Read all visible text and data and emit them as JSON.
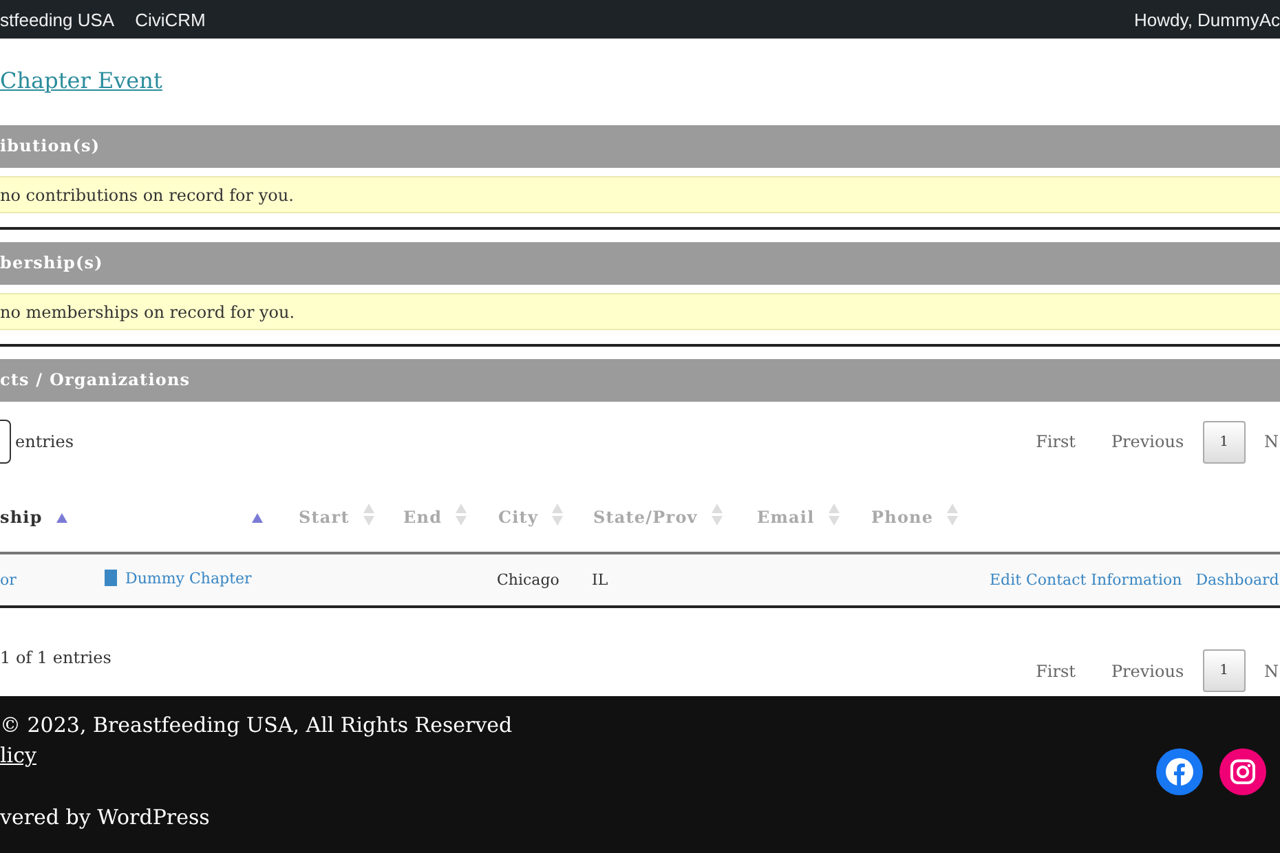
{
  "admin_bar": {
    "left_items": [
      "stfeeding USA",
      "CiviCRM"
    ],
    "account": "Howdy, DummyAc"
  },
  "links": [
    "Chapter Event"
  ],
  "sections": [
    {
      "title": "ibution(s)",
      "notice": "no contributions on record for you."
    },
    {
      "title": "bership(s)",
      "notice": "no memberships on record for you."
    },
    {
      "title": "cts / Organizations"
    }
  ],
  "table_controls": {
    "length_label": "entries",
    "pagination": [
      {
        "label": "First",
        "selected": false
      },
      {
        "label": "Previous",
        "selected": false
      },
      {
        "label": "1",
        "selected": true
      },
      {
        "label": "N",
        "selected": false
      }
    ]
  },
  "table": {
    "columns": [
      {
        "label": "ship",
        "sorted": true
      },
      {
        "sorted": true
      },
      {
        "label": "Start",
        "sorted": false
      },
      {
        "label": "End",
        "sorted": false
      },
      {
        "label": "City",
        "sorted": false
      },
      {
        "label": "State/Prov",
        "sorted": false
      },
      {
        "label": "Email",
        "sorted": false
      },
      {
        "label": "Phone",
        "sorted": false
      },
      {}
    ],
    "rows": [
      {
        "cells": [
          {
            "kind": "link",
            "text": "or"
          },
          {
            "kind": "contact",
            "text": "Dummy Chapter"
          },
          {
            "kind": "empty"
          },
          {
            "kind": "empty"
          },
          {
            "kind": "text",
            "text": "Chicago"
          },
          {
            "kind": "text",
            "text": "IL"
          },
          {
            "kind": "empty"
          },
          {
            "kind": "empty"
          },
          {
            "kind": "actions",
            "links": [
              "Edit Contact Information",
              "Dashboard"
            ]
          }
        ]
      }
    ]
  },
  "table_info": {
    "text": "1 of 1 entries",
    "pagination": [
      {
        "label": "First",
        "selected": false
      },
      {
        "label": "Previous",
        "selected": false
      },
      {
        "label": "1",
        "selected": true
      },
      {
        "label": "N",
        "selected": false
      }
    ]
  },
  "footer": {
    "copyright": "© 2023, Breastfeeding USA, All Rights Reserved",
    "policy_link": "licy",
    "powered_by": "vered by WordPress",
    "social": [
      {
        "kind": "facebook"
      },
      {
        "kind": "instagram"
      }
    ]
  }
}
